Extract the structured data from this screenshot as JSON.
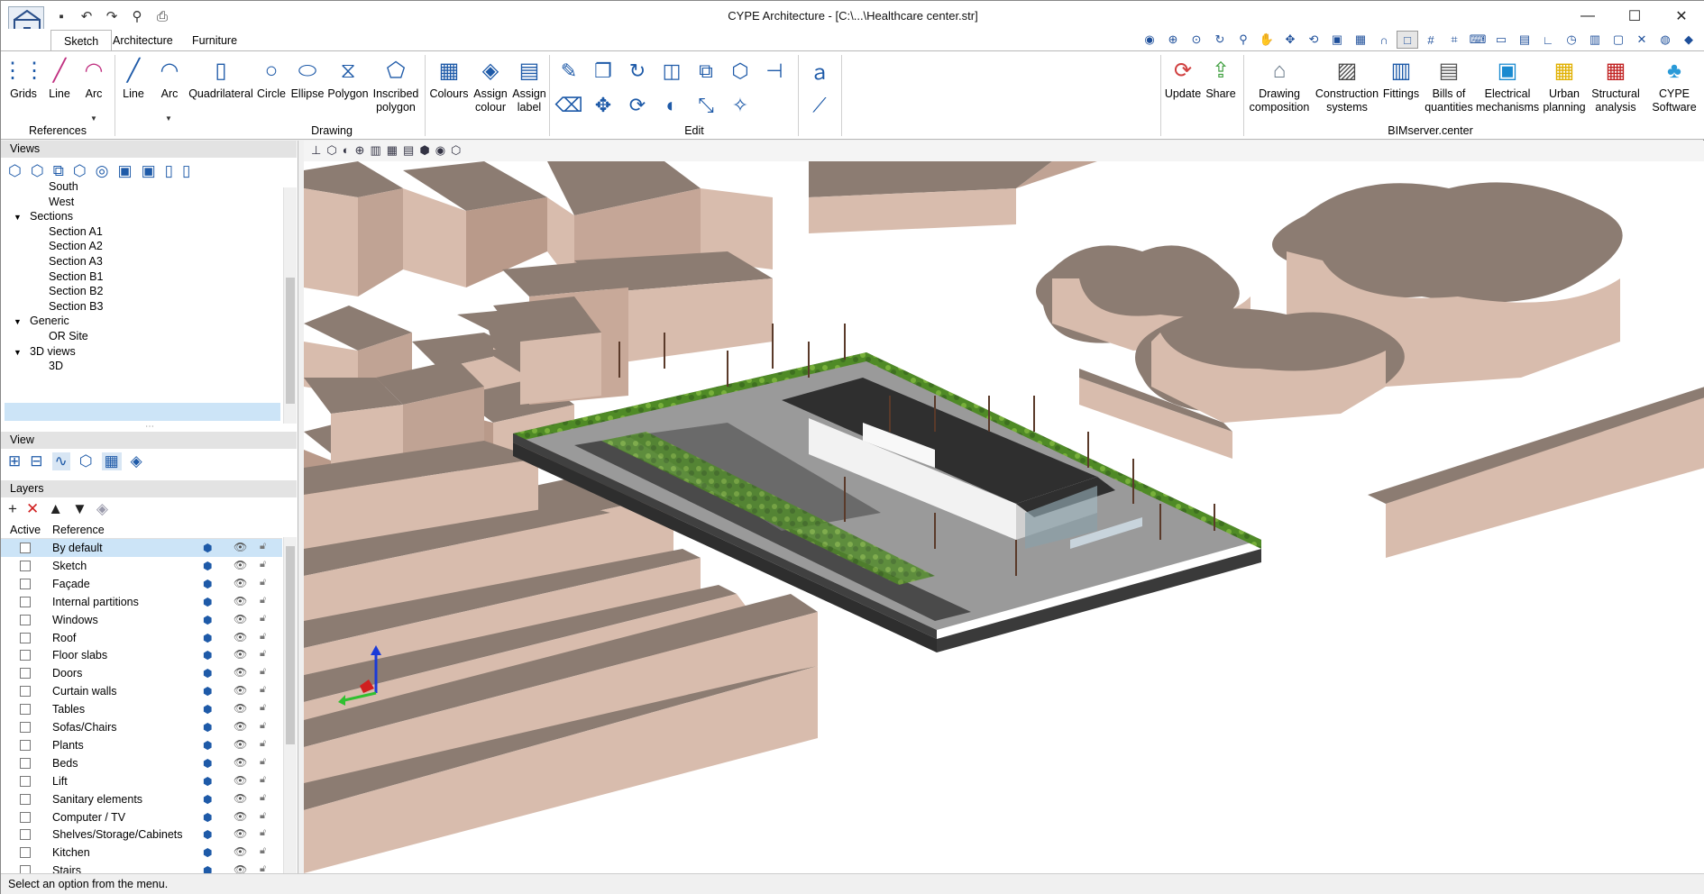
{
  "window": {
    "title": "CYPE Architecture - [C:\\...\\Healthcare center.str]",
    "minimize": "—",
    "maximize": "☐",
    "close": "✕"
  },
  "quick_access": [
    "save-icon",
    "undo-icon",
    "redo-icon",
    "zoom-icon",
    "print-icon"
  ],
  "tabs": [
    "Sketch",
    "Architecture",
    "Furniture"
  ],
  "ribbon": {
    "references": {
      "label": "References",
      "items": [
        "Grids",
        "Line",
        "Arc"
      ]
    },
    "drawing": {
      "label": "Drawing",
      "items": [
        "Line",
        "Arc",
        "Quadrilateral",
        "Circle",
        "Ellipse",
        "Polygon",
        "Inscribed polygon",
        "Colours",
        "Assign colour",
        "Assign label"
      ]
    },
    "edit": {
      "label": "Edit"
    },
    "bimserver": {
      "label": "BIMserver.center",
      "items": [
        "Update",
        "Share",
        "Drawing composition",
        "Construction systems",
        "Fittings",
        "Bills of quantities",
        "Electrical mechanisms",
        "Urban planning",
        "Structural analysis",
        "CYPE Software"
      ]
    }
  },
  "views_panel": {
    "title": "Views",
    "tree": [
      {
        "label": "South",
        "level": 2
      },
      {
        "label": "West",
        "level": 2
      },
      {
        "label": "Sections",
        "level": 1,
        "expanded": true
      },
      {
        "label": "Section A1",
        "level": 2
      },
      {
        "label": "Section A2",
        "level": 2
      },
      {
        "label": "Section A3",
        "level": 2
      },
      {
        "label": "Section B1",
        "level": 2
      },
      {
        "label": "Section B2",
        "level": 2
      },
      {
        "label": "Section B3",
        "level": 2
      },
      {
        "label": "Generic",
        "level": 1,
        "expanded": true
      },
      {
        "label": "OR Site",
        "level": 2
      },
      {
        "label": "3D views",
        "level": 1,
        "expanded": true
      },
      {
        "label": "3D",
        "level": 2,
        "selected": true
      }
    ]
  },
  "view_panel": {
    "title": "View"
  },
  "layers_panel": {
    "title": "Layers",
    "columns": [
      "Active",
      "Reference"
    ],
    "rows": [
      "By default",
      "Sketch",
      "Façade",
      "Internal partitions",
      "Windows",
      "Roof",
      "Floor slabs",
      "Doors",
      "Curtain walls",
      "Tables",
      "Sofas/Chairs",
      "Plants",
      "Beds",
      "Lift",
      "Sanitary elements",
      "Computer / TV",
      "Shelves/Storage/Cabinets",
      "Kitchen",
      "Stairs"
    ]
  },
  "status": "Select an option from the menu.",
  "colors": {
    "accent": "#1e5aa8",
    "building": "#d6b8a8",
    "building_top": "#8a7a70",
    "site_floor": "#6f6f6f",
    "hedge": "#5a8a2a"
  }
}
